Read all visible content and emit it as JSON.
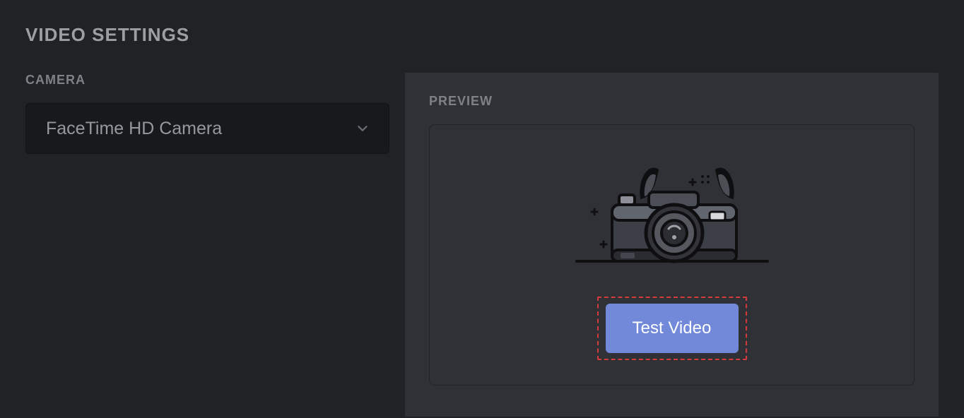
{
  "section": {
    "title": "VIDEO SETTINGS"
  },
  "camera": {
    "label": "CAMERA",
    "selected": "FaceTime HD Camera"
  },
  "preview": {
    "label": "PREVIEW",
    "test_button": "Test Video"
  },
  "colors": {
    "accent": "#7289da",
    "highlight_border": "#d63b3b"
  }
}
